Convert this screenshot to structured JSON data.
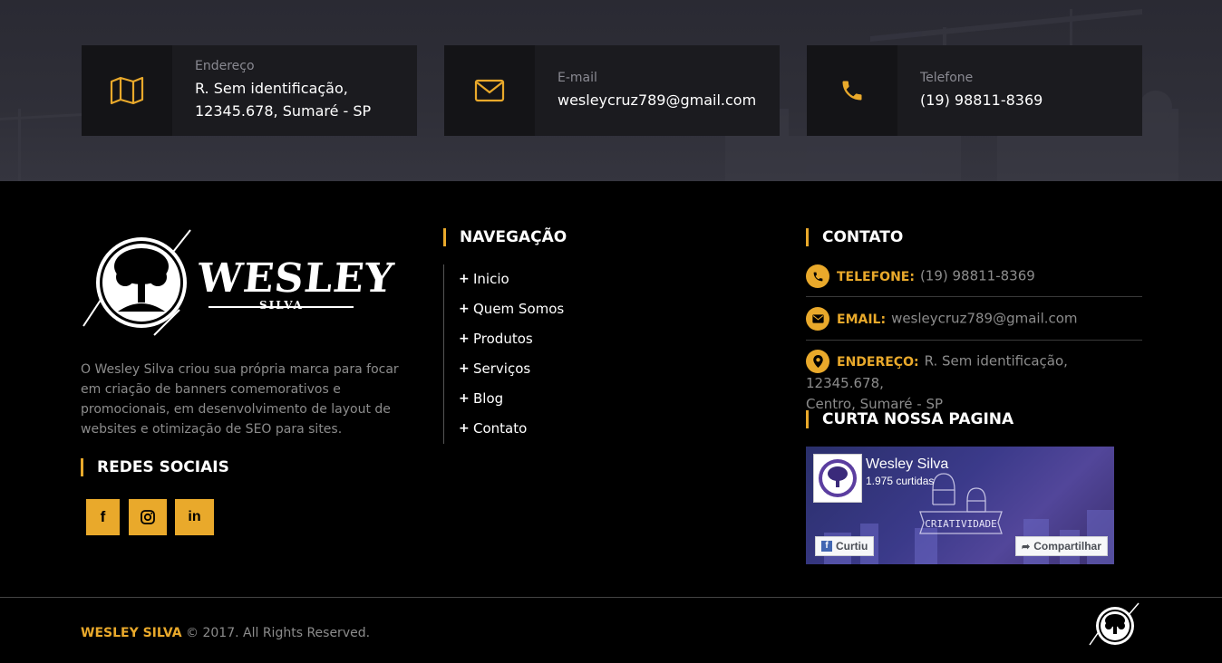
{
  "top_info": [
    {
      "label": "Endereço",
      "value_line1": "R. Sem identificação,",
      "value_line2": "12345.678, Sumaré - SP",
      "icon": "map-icon"
    },
    {
      "label": "E-mail",
      "value_line1": "wesleycruz789@gmail.com",
      "value_line2": "",
      "icon": "envelope-icon"
    },
    {
      "label": "Telefone",
      "value_line1": "(19) 98811-8369",
      "value_line2": "",
      "icon": "phone-icon"
    }
  ],
  "logo": {
    "name": "WESLEY",
    "sub": "SILVA"
  },
  "about": "O Wesley Silva criou sua própria marca para focar em criação de banners comemorativos e promocionais, em desenvolvimento de layout de websites e otimização de SEO para sites.",
  "social": {
    "heading": "REDES SOCIAIS",
    "buttons": [
      {
        "label": "f",
        "icon": "facebook-icon"
      },
      {
        "label": "",
        "icon": "instagram-icon"
      },
      {
        "label": "in",
        "icon": "linkedin-icon"
      }
    ]
  },
  "navigation": {
    "heading": "NAVEGAÇÃO",
    "items": [
      "Inicio",
      "Quem Somos",
      "Produtos",
      "Serviços",
      "Blog",
      "Contato"
    ]
  },
  "contact": {
    "heading": "CONTATO",
    "phone_label": "TELEFONE:",
    "phone_value": "(19) 98811-8369",
    "email_label": "EMAIL:",
    "email_value": "wesleycruz789@gmail.com",
    "address_label": "ENDEREÇO:",
    "address_value_line1": "R. Sem identificação, 12345.678,",
    "address_value_line2": "Centro, Sumaré - SP"
  },
  "facebook": {
    "heading": "CURTA NOSSA PAGINA",
    "page_name": "Wesley Silva",
    "likes": "1.975 curtidas",
    "like_button": "Curtiu",
    "share_button": "Compartilhar"
  },
  "footer": {
    "brand": "WESLEY SILVA",
    "rights": " © 2017. All Rights Reserved."
  },
  "colors": {
    "accent": "#e9a92b",
    "background": "#000000",
    "band": "#2f2f38"
  }
}
